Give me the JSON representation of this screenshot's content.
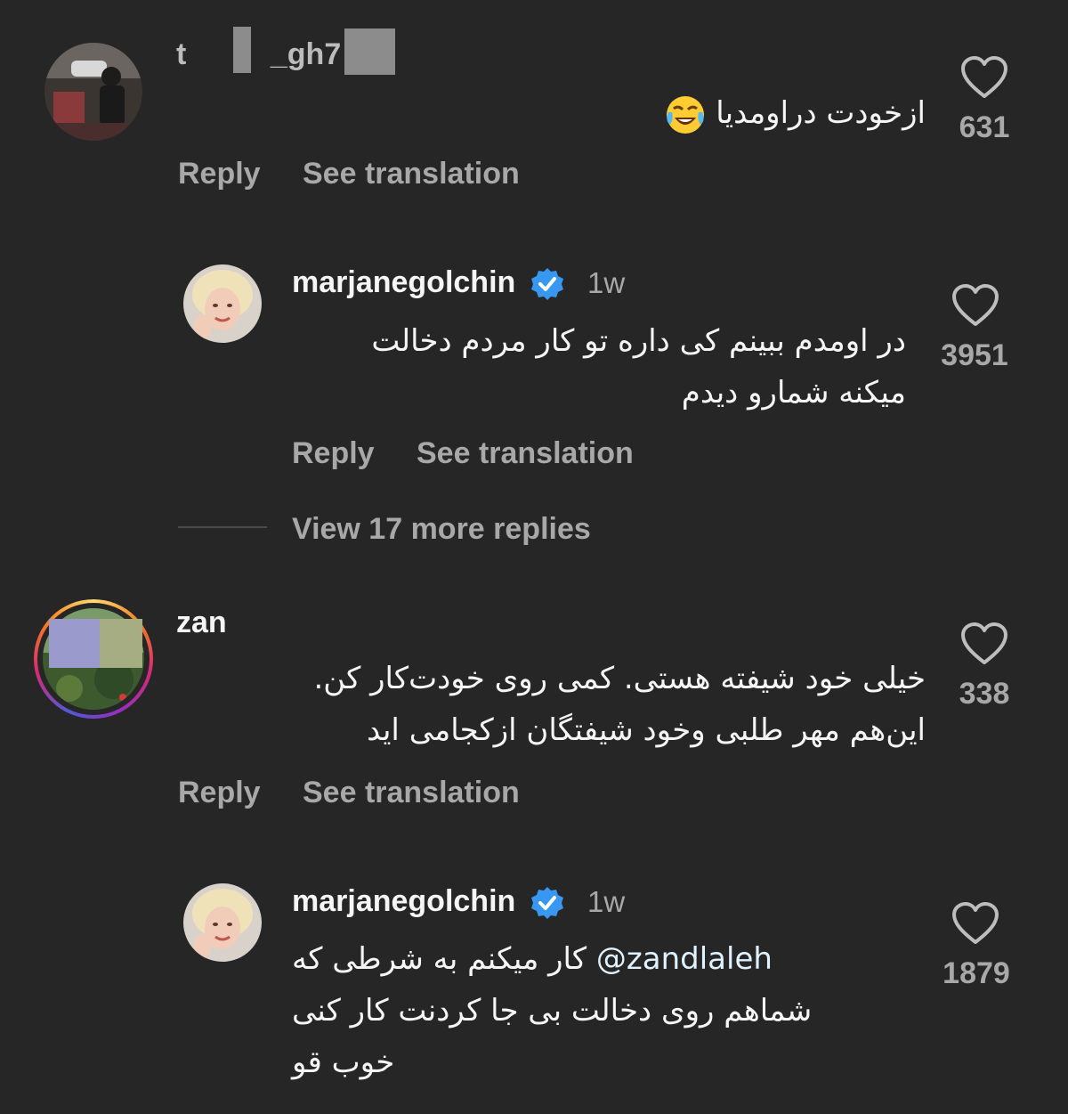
{
  "comments": [
    {
      "username": "t     _gh7",
      "text": "ازخودت دراومدیا",
      "emoji": "face-with-tears-of-joy",
      "likes": "631",
      "reply_label": "Reply",
      "translate_label": "See translation"
    },
    {
      "username": "marjanegolchin",
      "verified": true,
      "time": "1w",
      "text_line1": "در اومدم ببینم کی داره تو کار مردم دخالت",
      "text_line2": "میکنه شمارو دیدم",
      "likes": "3951",
      "reply_label": "Reply",
      "translate_label": "See translation"
    },
    {
      "username": "zan",
      "text_line1": "خیلی خود شیفته هستی. کمی روی خودت‌کار کن.",
      "text_line2": "این‌هم مهر طلبی وخود شیفتگان ازکجامی اید",
      "likes": "338",
      "reply_label": "Reply",
      "translate_label": "See translation"
    },
    {
      "username": "marjanegolchin",
      "verified": true,
      "time": "1w",
      "mention": "@zandlaleh",
      "text_line1_after_mention": "کار میکنم به شرطی که",
      "text_line2": "شماهم روی دخالت بی جا کردنت کار کنی",
      "text_line3": "خوب قو",
      "likes": "1879"
    }
  ],
  "view_more_replies": "View 17 more replies",
  "colors": {
    "background": "#262626",
    "primary_text": "#f5f5f5",
    "secondary_text": "#a8a8a8",
    "verified_blue": "#3897f0"
  },
  "icons": [
    "heart-icon",
    "verified-badge-icon",
    "face-with-tears-of-joy-emoji"
  ]
}
